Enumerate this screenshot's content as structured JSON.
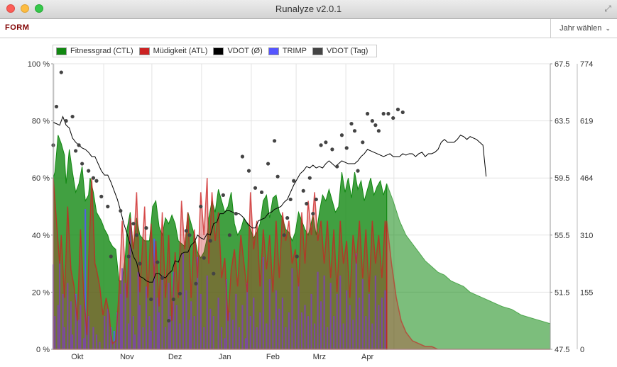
{
  "window": {
    "title": "Runalyze v2.0.1"
  },
  "toolbar": {
    "section_label": "FORM",
    "year_button_label": "Jahr wählen"
  },
  "chart_data": {
    "type": "area",
    "title": "",
    "x_ticks": [
      "Okt",
      "Nov",
      "Dez",
      "Jan",
      "Feb",
      "Mrz",
      "Apr"
    ],
    "y_left": {
      "ticks": [
        "0 %",
        "20 %",
        "40 %",
        "60 %",
        "80 %",
        "100 %"
      ],
      "range": [
        0,
        100
      ]
    },
    "y_right1": {
      "ticks": [
        "47.5",
        "51.5",
        "55.5",
        "59.5",
        "63.5",
        "67.5"
      ],
      "range": [
        47.5,
        67.5
      ]
    },
    "y_right2": {
      "ticks": [
        "0",
        "155",
        "310",
        "464",
        "619",
        "774"
      ],
      "range": [
        0,
        774
      ]
    },
    "grid": true,
    "legend_position": "top-left",
    "colors": {
      "ctl": "#118811",
      "atl": "#cc2222",
      "vdot_avg": "#000000",
      "trimp": "#5555ff",
      "vdot_day": "#444444"
    },
    "series": [
      {
        "name": "Fitnessgrad (CTL)",
        "type": "area",
        "axis": "y_left",
        "x": [
          0,
          1,
          3,
          5,
          7,
          8,
          10,
          12,
          14,
          16,
          18,
          20,
          22,
          23,
          25,
          27,
          29,
          30,
          32,
          34,
          35,
          37,
          39,
          41,
          43,
          45,
          46,
          48,
          50,
          52,
          54,
          57,
          60,
          62,
          64,
          66,
          68,
          70,
          72,
          74,
          76,
          78,
          80,
          82,
          84,
          86,
          88,
          90,
          92,
          94,
          96,
          97,
          99,
          101,
          103,
          105,
          107,
          109,
          111,
          113,
          115,
          117,
          119,
          121,
          123,
          125,
          127,
          129,
          131,
          133,
          135,
          137,
          139,
          141,
          143,
          145,
          147,
          149,
          151,
          153,
          155,
          157,
          159,
          160,
          162,
          164,
          166,
          168,
          170,
          172,
          174,
          176,
          178,
          180,
          182,
          184,
          186,
          188,
          190,
          192,
          194,
          196,
          198,
          200,
          202,
          204,
          206,
          208
        ],
        "values": [
          60,
          62,
          75,
          72,
          68,
          58,
          70,
          62,
          55,
          58,
          64,
          52,
          54,
          60,
          55,
          48,
          46,
          45,
          42,
          40,
          38,
          36,
          35,
          24,
          24,
          33,
          42,
          48,
          35,
          46,
          40,
          38,
          38,
          50,
          52,
          43,
          40,
          46,
          44,
          47,
          44,
          38,
          37,
          36,
          48,
          44,
          40,
          34,
          32,
          34,
          39,
          46,
          52,
          48,
          56,
          52,
          48,
          50,
          55,
          44,
          40,
          42,
          46,
          44,
          42,
          39,
          41,
          44,
          52,
          54,
          46,
          53,
          54,
          48,
          46,
          42,
          41,
          38,
          41,
          48,
          45,
          42,
          40,
          42,
          47,
          40,
          48,
          54,
          52,
          56,
          52,
          48,
          50,
          62,
          55,
          60,
          53,
          62,
          56,
          59,
          52,
          56,
          60,
          54,
          57,
          59,
          54,
          58
        ],
        "forecast_x": [
          208,
          212,
          216,
          220,
          224,
          228,
          232,
          236,
          240,
          244,
          248,
          252,
          256,
          260,
          264,
          268,
          272,
          276,
          280,
          286,
          292,
          298,
          304,
          310
        ],
        "forecast_values": [
          58,
          52,
          45,
          40,
          37,
          34,
          31,
          29,
          27,
          26,
          24,
          23,
          22,
          20,
          19,
          18,
          17,
          16,
          15,
          14,
          12,
          11,
          10,
          9
        ]
      },
      {
        "name": "Müdigkeit (ATL)",
        "type": "area",
        "axis": "y_left",
        "x": [
          0,
          2,
          4,
          5,
          7,
          9,
          11,
          13,
          15,
          17,
          19,
          21,
          22,
          24,
          26,
          27,
          29,
          31,
          33,
          35,
          36,
          37,
          39,
          41,
          43,
          46,
          48,
          50,
          52,
          54,
          55,
          57,
          59,
          61,
          63,
          64,
          66,
          68,
          70,
          72,
          74,
          76,
          78,
          80,
          82,
          84,
          86,
          88,
          90,
          92,
          94,
          96,
          97,
          99,
          101,
          103,
          105,
          107,
          109,
          111,
          113,
          115,
          117,
          119,
          121,
          123,
          125,
          127,
          129,
          131,
          133,
          135,
          137,
          139,
          141,
          143,
          145,
          147,
          149,
          151,
          153,
          155,
          157,
          159,
          161,
          163,
          165,
          167,
          169,
          171,
          173,
          175,
          177,
          179,
          181,
          183,
          185,
          187,
          189,
          191,
          193,
          195,
          197,
          199,
          201,
          203,
          205,
          207,
          208
        ],
        "values": [
          60,
          45,
          30,
          40,
          18,
          50,
          28,
          22,
          10,
          42,
          20,
          5,
          30,
          60,
          30,
          28,
          22,
          12,
          18,
          12,
          5,
          2,
          3,
          20,
          45,
          18,
          46,
          35,
          55,
          20,
          30,
          50,
          18,
          44,
          25,
          38,
          15,
          48,
          18,
          40,
          10,
          34,
          18,
          52,
          35,
          48,
          18,
          42,
          25,
          55,
          40,
          60,
          30,
          55,
          38,
          48,
          25,
          32,
          10,
          28,
          35,
          22,
          40,
          30,
          20,
          55,
          35,
          45,
          22,
          42,
          28,
          40,
          20,
          45,
          25,
          48,
          38,
          45,
          30,
          35,
          22,
          48,
          30,
          52,
          40,
          55,
          38,
          45,
          30,
          45,
          25,
          42,
          20,
          45,
          30,
          38,
          18,
          40,
          30,
          45,
          25,
          42,
          20,
          45,
          30,
          40,
          25,
          45,
          40
        ],
        "forecast_x": [
          208,
          211,
          214,
          217,
          220,
          224,
          228,
          232,
          236,
          240,
          246,
          252,
          258,
          264,
          270,
          280,
          290,
          300,
          310
        ],
        "forecast_values": [
          45,
          30,
          18,
          10,
          6,
          3,
          2,
          1,
          1,
          0,
          0,
          0,
          0,
          0,
          0,
          0,
          0,
          0,
          0
        ]
      },
      {
        "name": "VDOT (Ø)",
        "type": "line",
        "axis": "y_right1",
        "x": [
          0,
          2,
          4,
          6,
          8,
          10,
          12,
          14,
          16,
          18,
          20,
          22,
          24,
          26,
          28,
          30,
          32,
          34,
          36,
          38,
          40,
          42,
          44,
          46,
          48,
          50,
          52,
          54,
          56,
          58,
          60,
          62,
          64,
          66,
          68,
          70,
          72,
          74,
          76,
          78,
          80,
          82,
          84,
          86,
          88,
          90,
          92,
          94,
          96,
          98,
          100,
          102,
          104,
          106,
          108,
          110,
          112,
          114,
          116,
          118,
          120,
          122,
          124,
          126,
          128,
          130,
          132,
          134,
          136,
          138,
          140,
          142,
          144,
          146,
          148,
          150,
          152,
          154,
          156,
          158,
          160,
          162,
          164,
          166,
          168,
          170,
          172,
          174,
          176,
          178,
          180,
          182,
          184,
          186,
          188,
          190,
          192,
          194,
          196,
          198,
          200,
          202,
          204,
          206,
          208,
          210,
          212,
          214,
          216,
          218,
          220,
          222,
          224,
          226,
          228,
          230,
          232,
          234,
          236,
          238,
          240,
          242,
          244,
          246,
          248,
          250,
          252,
          254,
          256,
          258,
          260,
          262,
          264,
          266,
          268,
          270
        ],
        "values": [
          63.4,
          63.3,
          63.2,
          63.8,
          63.2,
          63.0,
          62.3,
          62.0,
          61.8,
          61.6,
          61.5,
          61.3,
          61.0,
          61.0,
          60.5,
          60.0,
          59.7,
          59.7,
          59.2,
          58.6,
          58.0,
          57.2,
          56.3,
          55.6,
          54.8,
          54.0,
          53.6,
          52.6,
          52.5,
          52.3,
          52.2,
          52.2,
          52.8,
          52.8,
          52.6,
          52.5,
          52.8,
          53.0,
          53.7,
          53.6,
          54.2,
          54.3,
          54.3,
          54.8,
          55.0,
          55.5,
          55.3,
          55.2,
          55.6,
          55.5,
          56.3,
          56.4,
          57.0,
          57.0,
          57.2,
          57.2,
          57.1,
          57.0,
          57.0,
          56.8,
          56.5,
          56.2,
          56.0,
          56.0,
          56.5,
          56.6,
          56.7,
          57.0,
          57.1,
          57.3,
          57.4,
          57.5,
          57.8,
          58.0,
          58.5,
          59.0,
          59.4,
          59.8,
          60.0,
          60.3,
          60.2,
          60.4,
          60.2,
          60.3,
          60.2,
          60.5,
          60.7,
          60.5,
          60.3,
          60.5,
          60.7,
          60.6,
          60.5,
          60.5,
          60.5,
          60.7,
          61.0,
          61.2,
          61.5,
          61.4,
          61.3,
          61.2,
          61.1,
          61.0,
          61.1,
          61.2,
          61.0,
          61.0,
          61.0,
          61.2,
          61.1,
          61.2,
          61.2,
          61.0,
          61.2,
          61.3,
          61.0,
          61.2,
          61.2,
          61.3,
          61.5,
          62.0,
          62.2,
          62.0,
          62.0,
          62.0,
          62.2,
          62.5,
          62.4,
          62.2,
          62.4,
          62.3,
          62.2,
          62.0,
          61.8,
          59.6
        ]
      },
      {
        "name": "TRIMP",
        "type": "bar",
        "axis": "y_right2",
        "x": [
          0,
          1,
          3,
          4,
          6,
          7,
          9,
          11,
          12,
          14,
          16,
          17,
          19,
          20,
          22,
          25,
          27,
          29,
          32,
          34,
          36,
          38,
          40,
          42,
          43,
          45,
          47,
          48,
          50,
          51,
          53,
          54,
          56,
          58,
          60,
          61,
          63,
          65,
          66,
          68,
          70,
          72,
          73,
          75,
          77,
          79,
          81,
          83,
          85,
          86,
          88,
          90,
          92,
          94,
          96,
          98,
          100,
          103,
          105,
          107,
          108,
          110,
          112,
          114,
          116,
          118,
          120,
          121,
          123,
          125,
          127,
          129,
          131,
          133,
          135,
          137,
          139,
          141,
          143,
          145,
          147,
          149,
          151,
          153,
          155,
          157,
          159,
          161,
          163,
          165,
          167,
          169,
          171,
          173,
          175,
          177,
          179,
          181,
          183,
          185,
          187,
          189,
          191,
          193,
          195,
          197,
          199,
          201,
          203,
          205,
          207
        ],
        "values": [
          230,
          90,
          120,
          240,
          150,
          60,
          180,
          130,
          40,
          150,
          80,
          120,
          30,
          380,
          90,
          60,
          40,
          20,
          90,
          110,
          60,
          50,
          100,
          150,
          220,
          180,
          70,
          350,
          90,
          40,
          210,
          120,
          60,
          170,
          90,
          50,
          300,
          140,
          100,
          200,
          60,
          180,
          90,
          210,
          120,
          70,
          260,
          160,
          80,
          130,
          90,
          250,
          150,
          60,
          200,
          110,
          90,
          140,
          60,
          30,
          190,
          100,
          80,
          150,
          60,
          120,
          30,
          180,
          90,
          140,
          60,
          100,
          250,
          70,
          190,
          80,
          160,
          110,
          140,
          60,
          100,
          220,
          80,
          180,
          100,
          120,
          90,
          150,
          70,
          210,
          130,
          200,
          60,
          180,
          90,
          150,
          200,
          70,
          160,
          120,
          80,
          260,
          140,
          190,
          90,
          150,
          70,
          200,
          120,
          140,
          160
        ]
      },
      {
        "name": "VDOT (Tag)",
        "type": "scatter",
        "axis": "y_right1",
        "x": [
          0,
          2,
          5,
          8,
          12,
          14,
          16,
          18,
          22,
          25,
          27,
          30,
          34,
          36,
          42,
          47,
          50,
          52,
          54,
          58,
          61,
          65,
          68,
          72,
          75,
          79,
          83,
          85,
          89,
          92,
          94,
          98,
          100,
          106,
          110,
          114,
          118,
          122,
          126,
          130,
          134,
          138,
          140,
          144,
          146,
          148,
          150,
          152,
          156,
          158,
          160,
          162,
          164,
          167,
          170,
          174,
          177,
          180,
          183,
          186,
          188,
          190,
          193,
          196,
          199,
          201,
          203,
          206,
          209,
          212,
          215,
          218
        ],
        "values": [
          61.8,
          64.5,
          66.9,
          63.5,
          63.8,
          61.4,
          61.8,
          60.5,
          60.0,
          59.5,
          59.3,
          58.2,
          57.5,
          54.0,
          57.2,
          54.0,
          56.3,
          55.5,
          53.5,
          56.0,
          51.0,
          53.6,
          52.5,
          49.5,
          51.0,
          51.4,
          55.8,
          55.5,
          52.1,
          57.5,
          53.9,
          55.1,
          52.8,
          58.3,
          55.5,
          57.0,
          61.0,
          60.0,
          58.8,
          58.5,
          60.5,
          62.1,
          59.6,
          55.5,
          56.7,
          58.0,
          59.3,
          54.0,
          58.6,
          57.7,
          59.5,
          57.0,
          58.0,
          61.8,
          62.0,
          61.5,
          60.3,
          62.5,
          61.6,
          63.3,
          62.8,
          60.0,
          62.0,
          64.0,
          63.5,
          63.2,
          62.8,
          64.0,
          64.0,
          63.7,
          64.3,
          64.1
        ]
      }
    ]
  }
}
